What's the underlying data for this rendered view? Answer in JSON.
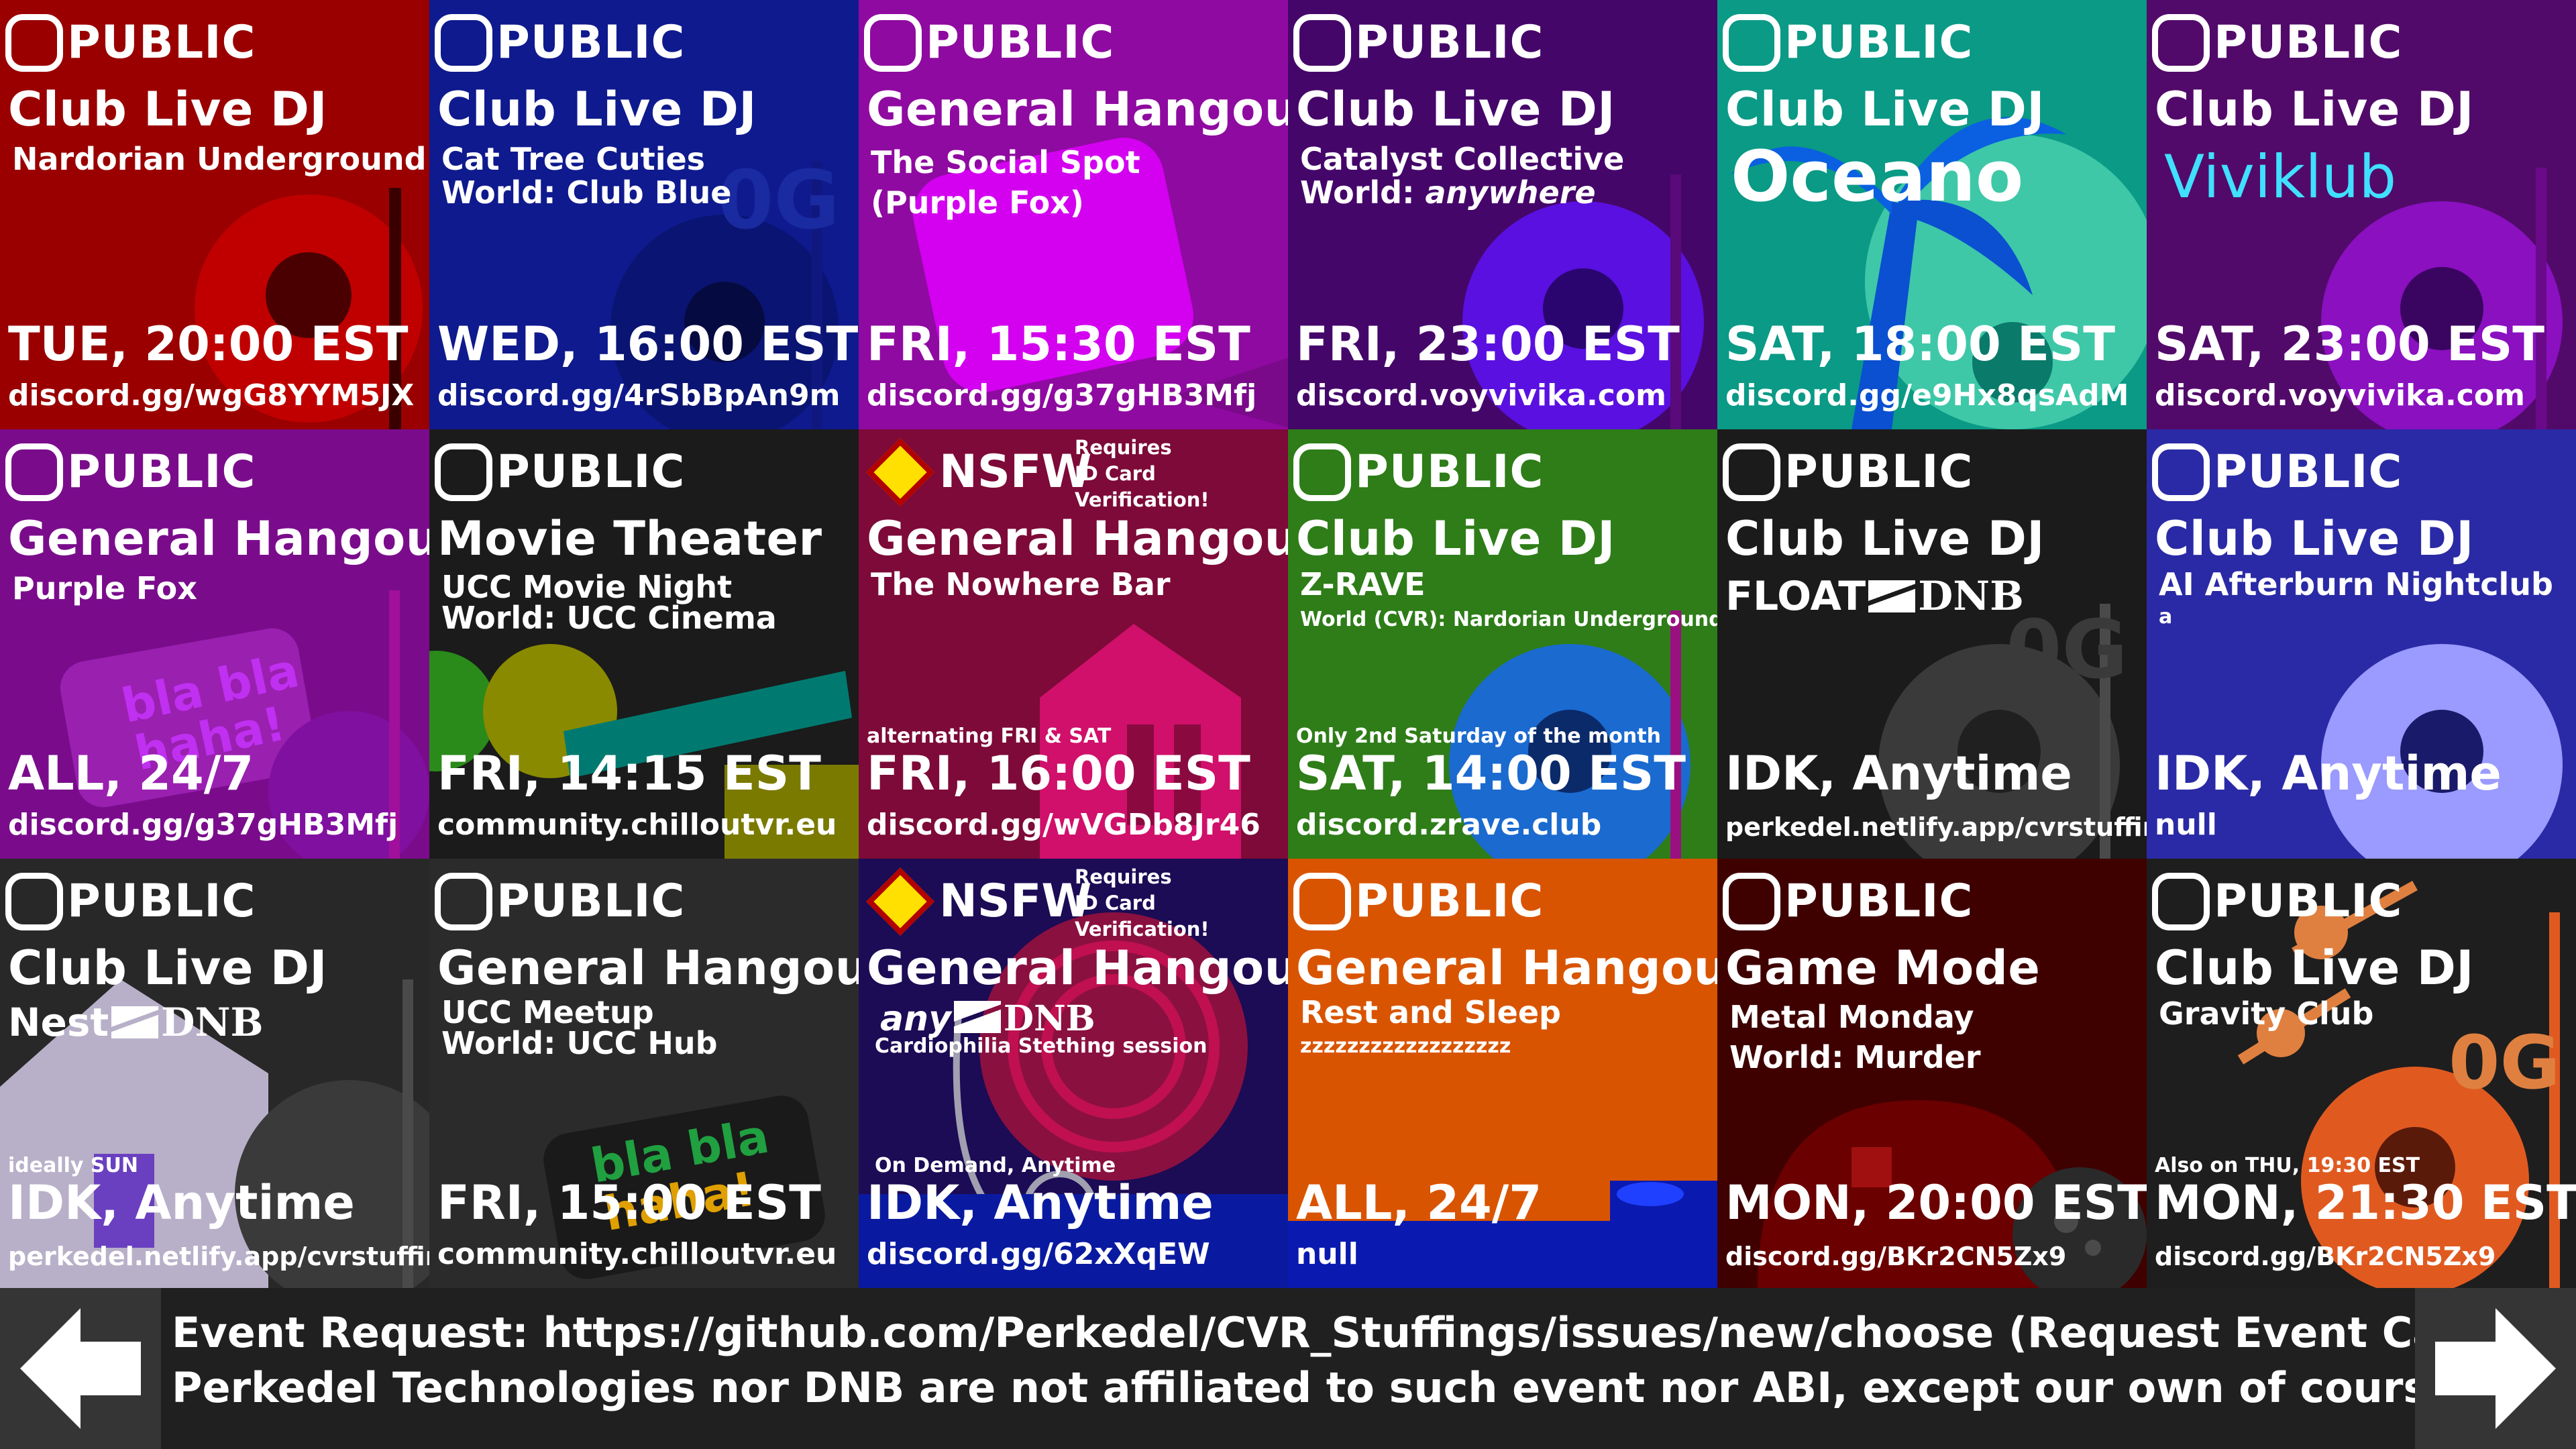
{
  "cards": [
    {
      "bg": "#9a0000",
      "access": "PUBLIC",
      "type": "Club Live DJ",
      "sub": "Nardorian Underground",
      "time": "TUE, 20:00 EST",
      "link": "discord.gg/wgG8YYM5JX"
    },
    {
      "bg": "#0f1a8e",
      "access": "PUBLIC",
      "type": "Club Live DJ",
      "sub": "Cat Tree Cuties",
      "sub2": "World: Club Blue",
      "time": "WED, 16:00 EST",
      "link": "discord.gg/4rSbBpAn9m"
    },
    {
      "bg": "#8f0aa0",
      "access": "PUBLIC",
      "type": "General Hangout",
      "sub": "The Social Spot",
      "sub2": "(Purple Fox)",
      "time": "FRI, 15:30 EST",
      "link": "discord.gg/g37gHB3Mfj"
    },
    {
      "bg": "#45066a",
      "access": "PUBLIC",
      "type": "Club Live DJ",
      "sub": "Catalyst Collective",
      "sub2_prefix": "World: ",
      "sub2_em": "anywhere",
      "time": "FRI, 23:00 EST",
      "link": "discord.voyvivika.com"
    },
    {
      "bg": "#0a9a86",
      "access": "PUBLIC",
      "type": "Club Live DJ",
      "time": "SAT, 18:00 EST",
      "link": "discord.gg/e9Hx8qsAdM"
    },
    {
      "bg": "#520a6a",
      "access": "PUBLIC",
      "type": "Club Live DJ",
      "time": "SAT, 23:00 EST",
      "link": "discord.voyvivika.com"
    },
    {
      "bg": "#7a0c8c",
      "access": "PUBLIC",
      "type": "General Hangout",
      "sub": "Purple Fox",
      "time": "ALL, 24/7",
      "link": "discord.gg/g37gHB3Mfj"
    },
    {
      "bg": "#1b1b1b",
      "access": "PUBLIC",
      "type": "Movie Theater",
      "sub": "UCC Movie Night",
      "sub2": "World: UCC Cinema",
      "time": "FRI, 14:15 EST",
      "link": "community.chilloutvr.eu"
    },
    {
      "bg": "#7d0a38",
      "access": "NSFW",
      "req": "Requires\nID Card\nVerification!",
      "type": "General Hangout",
      "sub": "The Nowhere Bar",
      "note": "alternating FRI & SAT",
      "time": "FRI, 16:00 EST",
      "link": "discord.gg/wVGDb8Jr46"
    },
    {
      "bg": "#2e7d18",
      "access": "PUBLIC",
      "type": "Club Live DJ",
      "sub": "Z-RAVE",
      "sub_small": "World (CVR): Nardorian Underground",
      "note": "Only 2nd Saturday of the month",
      "time": "SAT, 14:00 EST",
      "link": "discord.zrave.club"
    },
    {
      "bg": "#1b1b1b",
      "access": "PUBLIC",
      "type": "Club Live DJ",
      "time": "IDK, Anytime",
      "link": "perkedel.netlify.app/cvrstuffings"
    },
    {
      "bg": "#2a2aa6",
      "access": "PUBLIC",
      "type": "Club Live DJ",
      "sub": "AI Afterburn Nightclub",
      "sub_small": "a",
      "time": "IDK, Anytime",
      "link": "null"
    },
    {
      "bg": "#282828",
      "access": "PUBLIC",
      "type": "Club Live DJ",
      "note": "ideally SUN",
      "time": "IDK, Anytime",
      "link": "perkedel.netlify.app/cvrstuffings"
    },
    {
      "bg": "#2b2b2b",
      "access": "PUBLIC",
      "type": "General Hangout",
      "sub": "UCC Meetup",
      "sub2": "World: UCC Hub",
      "time": "FRI, 15:00 EST",
      "link": "community.chilloutvr.eu"
    },
    {
      "bg": "#1c0b55",
      "access": "NSFW",
      "req": "Requires\nID Card\nVerification!",
      "type": "General Hangout",
      "sub_small": "Cardiophilia Stething session",
      "note": "On Demand, Anytime",
      "time": "IDK, Anytime",
      "link": "discord.gg/62xXqEW"
    },
    {
      "bg": "#d95400",
      "access": "PUBLIC",
      "type": "General Hangout",
      "sub": "Rest and Sleep",
      "sub_small": "zzzzzzzzzzzzzzzzzz",
      "time": "ALL, 24/7",
      "link": "null"
    },
    {
      "bg": "#3f0000",
      "access": "PUBLIC",
      "type": "Game Mode",
      "sub": "Metal Monday",
      "sub2": "World: Murder",
      "time": "MON, 20:00 EST",
      "link": "discord.gg/BKr2CN5Zx9"
    },
    {
      "bg": "#1e1e1e",
      "access": "PUBLIC",
      "type": "Club Live DJ",
      "sub": "Gravity Club",
      "note": "Also on THU, 19:30 EST",
      "time": "MON, 21:30 EST",
      "link": "discord.gg/BKr2CN5Zx9"
    }
  ],
  "logos": {
    "oceano": "Oceano",
    "viviklub": "Viviklub",
    "float": "FLOAT",
    "nest": "Nest",
    "any": "any",
    "dnb": "DNB",
    "og": "0G",
    "blabla": "bla bla",
    "haha": "haha!",
    "exclaim": "!!"
  },
  "footer": {
    "line1": "Event Request: https://github.com/Perkedel/CVR_Stuffings/issues/new/choose (Request Event Calendar)",
    "line2": "Perkedel Technologies nor DNB are not affiliated to such event nor ABI, except our own of course lmao",
    "prev_icon": "arrow-left-icon",
    "next_icon": "arrow-right-icon"
  }
}
